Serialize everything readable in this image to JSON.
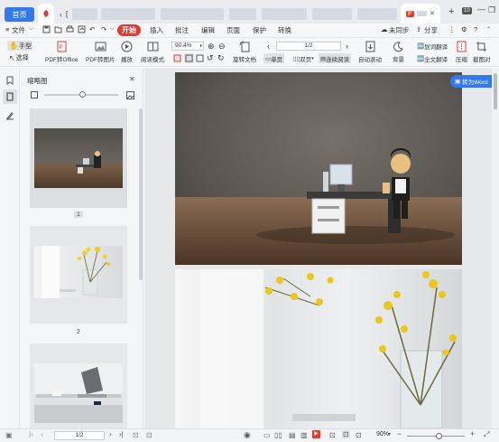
{
  "titlebar": {
    "home_tab": "首页",
    "pdf_tab_label": "P",
    "tab_partial": "[",
    "win_plus": "+",
    "win_min": "—",
    "win_max": "❐",
    "win_close": "✕",
    "win_badge": "10"
  },
  "menu": {
    "file": "文件",
    "start": "开始",
    "insert": "插入",
    "annotate": "批注",
    "edit": "编辑",
    "page": "页面",
    "protect": "保护",
    "convert": "转换",
    "sync": "未同步",
    "share": "分享"
  },
  "toolbar": {
    "hand": "手型",
    "select": "选择",
    "pdf_to_office": "PDF转Office",
    "pdf_to_image": "PDF转图片",
    "play": "播放",
    "read_mode": "阅读模式",
    "zoom_value": "90.4%",
    "rotate_doc": "旋转文档",
    "page_input": "1",
    "page_total": "/2",
    "single_page": "单页",
    "double_page": "双页",
    "continuous": "连续阅读",
    "auto_scroll": "自动滚动",
    "background": "背景",
    "word_translate": "划词翻译",
    "full_translate": "全文翻译",
    "compress": "压缩",
    "screenshot": "截图对"
  },
  "thumbnails": {
    "title": "缩略图",
    "close": "✕",
    "pages": [
      {
        "label": "1"
      },
      {
        "label": "2"
      },
      {
        "label": ""
      }
    ]
  },
  "viewer": {
    "to_word_button": "转为Word"
  },
  "status": {
    "page_input": "1",
    "page_total": "/2",
    "zoom": "90%",
    "zoom_level": 0.55
  },
  "colors": {
    "accent": "#3478ee",
    "start_red": "#e03a31"
  }
}
